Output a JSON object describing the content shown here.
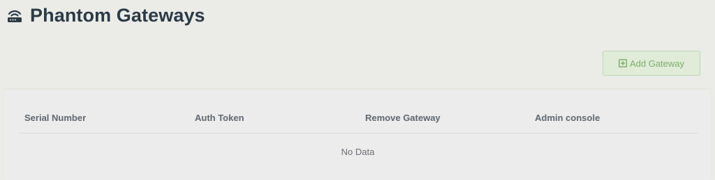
{
  "header": {
    "title": "Phantom Gateways",
    "icon": "router-icon"
  },
  "toolbar": {
    "add_label": "Add Gateway",
    "add_icon": "plus-square-icon",
    "accent_color": "#7fae6e"
  },
  "table": {
    "columns": [
      "Serial Number",
      "Auth Token",
      "Remove Gateway",
      "Admin console"
    ],
    "rows": [],
    "empty_text": "No Data"
  }
}
